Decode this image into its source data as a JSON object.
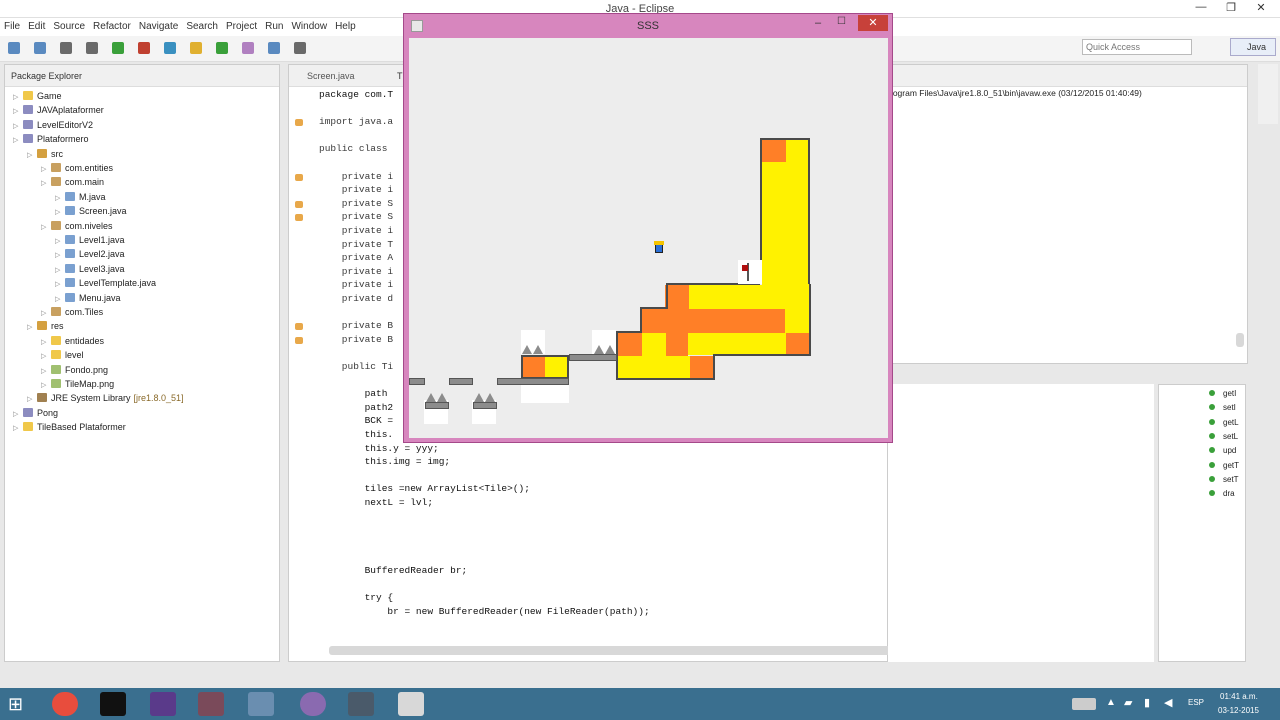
{
  "window": {
    "title": "Java - Eclipse"
  },
  "menu": [
    "File",
    "Edit",
    "Source",
    "Refactor",
    "Navigate",
    "Search",
    "Project",
    "Run",
    "Window",
    "Help"
  ],
  "toolbar": {
    "quick_access": "Quick Access",
    "perspective": "Java"
  },
  "package_explorer": {
    "title": "Package Explorer",
    "rows": [
      {
        "label": "Game",
        "indent": 0,
        "icon": "folder"
      },
      {
        "label": "JAVAplataformer",
        "indent": 0,
        "icon": "project"
      },
      {
        "label": "LevelEditorV2",
        "indent": 0,
        "icon": "project"
      },
      {
        "label": "Plataformero",
        "indent": 0,
        "icon": "project"
      },
      {
        "label": "src",
        "indent": 1,
        "icon": "src"
      },
      {
        "label": "com.entities",
        "indent": 2,
        "icon": "package"
      },
      {
        "label": "com.main",
        "indent": 2,
        "icon": "package"
      },
      {
        "label": "M.java",
        "indent": 3,
        "icon": "java"
      },
      {
        "label": "Screen.java",
        "indent": 3,
        "icon": "java"
      },
      {
        "label": "com.niveles",
        "indent": 2,
        "icon": "package"
      },
      {
        "label": "Level1.java",
        "indent": 3,
        "icon": "java"
      },
      {
        "label": "Level2.java",
        "indent": 3,
        "icon": "java"
      },
      {
        "label": "Level3.java",
        "indent": 3,
        "icon": "java"
      },
      {
        "label": "LevelTemplate.java",
        "indent": 3,
        "icon": "java"
      },
      {
        "label": "Menu.java",
        "indent": 3,
        "icon": "java"
      },
      {
        "label": "com.Tiles",
        "indent": 2,
        "icon": "package"
      },
      {
        "label": "res",
        "indent": 1,
        "icon": "src"
      },
      {
        "label": "entidades",
        "indent": 2,
        "icon": "folder"
      },
      {
        "label": "level",
        "indent": 2,
        "icon": "folder"
      },
      {
        "label": "Fondo.png",
        "indent": 2,
        "icon": "image"
      },
      {
        "label": "TileMap.png",
        "indent": 2,
        "icon": "image"
      },
      {
        "label": "JRE System Library",
        "indent": 1,
        "icon": "lib",
        "suffix": "[jre1.8.0_51]"
      },
      {
        "label": "Pong",
        "indent": 0,
        "icon": "project"
      },
      {
        "label": "TileBased Plataformer",
        "indent": 0,
        "icon": "folder"
      }
    ]
  },
  "editor": {
    "tabs": [
      "Screen.java",
      "T"
    ],
    "lines": [
      {
        "t": "package com.T",
        "kw": false
      },
      {
        "t": "",
        "kw": false
      },
      {
        "t": "import java.a",
        "kw": true
      },
      {
        "t": "",
        "kw": false
      },
      {
        "t": "public class",
        "kw": true
      },
      {
        "t": "",
        "kw": false
      },
      {
        "t": "    private i",
        "kw": true
      },
      {
        "t": "    private i",
        "kw": true
      },
      {
        "t": "    private S",
        "kw": true
      },
      {
        "t": "    private S",
        "kw": true
      },
      {
        "t": "    private i",
        "kw": true
      },
      {
        "t": "    private T",
        "kw": true
      },
      {
        "t": "    private A",
        "kw": true
      },
      {
        "t": "    private i",
        "kw": true
      },
      {
        "t": "    private i",
        "kw": true
      },
      {
        "t": "    private d",
        "kw": true
      },
      {
        "t": "",
        "kw": false
      },
      {
        "t": "    private B",
        "kw": true
      },
      {
        "t": "    private B",
        "kw": true
      },
      {
        "t": "",
        "kw": false
      },
      {
        "t": "    public Ti",
        "kw": true
      },
      {
        "t": "",
        "kw": false
      },
      {
        "t": "        path",
        "kw": false
      },
      {
        "t": "        path2",
        "kw": false
      },
      {
        "t": "        BCK =",
        "kw": false
      },
      {
        "t": "        this.",
        "kw": false
      },
      {
        "t": "        this.y = yyy;",
        "kw": false
      },
      {
        "t": "        this.img = img;",
        "kw": false
      },
      {
        "t": "",
        "kw": false
      },
      {
        "t": "        tiles =new ArrayList<Tile>();",
        "kw": false
      },
      {
        "t": "        nextL = lvl;",
        "kw": false
      },
      {
        "t": "",
        "kw": false
      },
      {
        "t": "",
        "kw": false
      },
      {
        "t": "",
        "kw": false
      },
      {
        "t": "",
        "kw": false
      },
      {
        "t": "        BufferedReader br;",
        "kw": false
      },
      {
        "t": "",
        "kw": false
      },
      {
        "t": "        try {",
        "kw": false
      },
      {
        "t": "            br = new BufferedReader(new FileReader(path));",
        "kw": false
      }
    ]
  },
  "console": {
    "header": "rogram Files\\Java\\jre1.8.0_51\\bin\\javaw.exe (03/12/2015 01:40:49)"
  },
  "outline": {
    "items": [
      "getI",
      "setI",
      "getL",
      "setL",
      "upd",
      "getT",
      "setT",
      "dra"
    ]
  },
  "game": {
    "title": "SSS"
  },
  "tray": {
    "lang": "ESP",
    "time": "01:41 a.m.",
    "date": "03-12-2015"
  },
  "colors": {
    "orange": "#ff7f27",
    "yellow": "#fff200",
    "grey": "#8c8c8c",
    "frame": "#d786be"
  }
}
